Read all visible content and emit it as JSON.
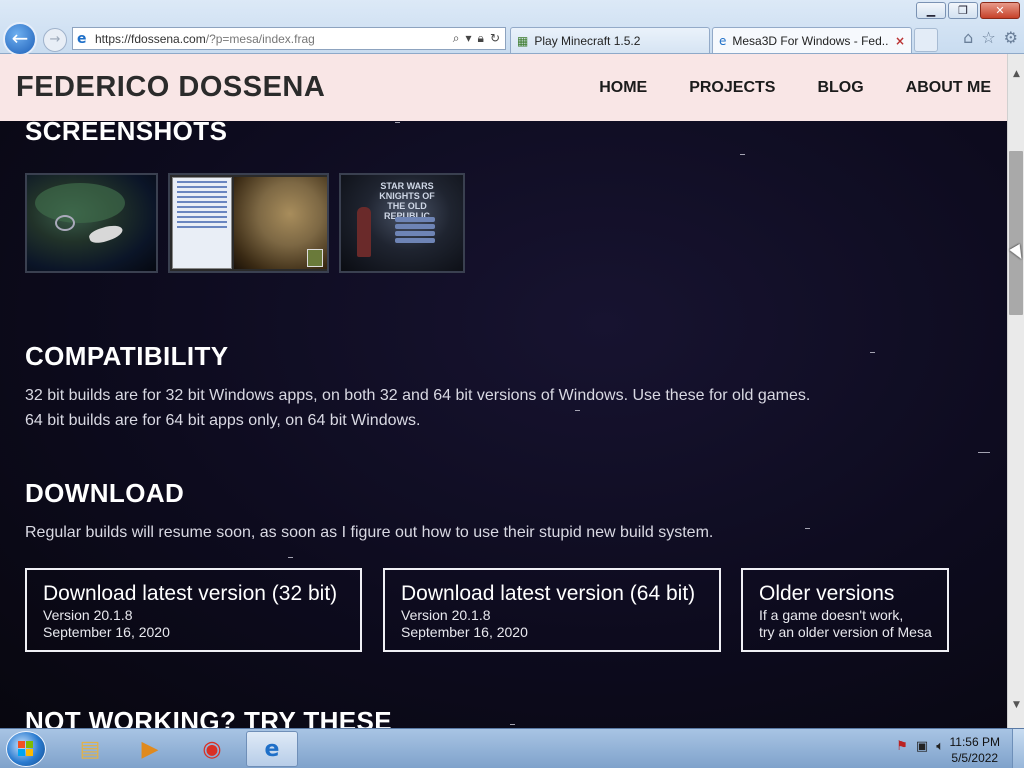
{
  "browser": {
    "address_url_main": "https://fdossena.com",
    "address_url_path": "/?p=mesa/index.frag",
    "tabs": [
      {
        "label": "Play Minecraft 1.5.2"
      },
      {
        "label": "Mesa3D For Windows - Fed..."
      }
    ],
    "window_buttons": {
      "minimize": "▁",
      "maximize": "❐",
      "close": "✕"
    }
  },
  "site": {
    "title": "FEDERICO DOSSENA",
    "nav": [
      "HOME",
      "PROJECTS",
      "BLOG",
      "ABOUT ME"
    ]
  },
  "sections": {
    "screenshots": {
      "heading": "SCREENSHOTS",
      "thumb3_caption": "STAR WARS KNIGHTS OF THE OLD REPUBLIC"
    },
    "compatibility": {
      "heading": "COMPATIBILITY",
      "line1": "32 bit builds are for 32 bit Windows apps, on both 32 and 64 bit versions of Windows. Use these for old games.",
      "line2": "64 bit builds are for 64 bit apps only, on 64 bit Windows."
    },
    "download": {
      "heading": "DOWNLOAD",
      "text": "Regular builds will resume soon, as soon as I figure out how to use their stupid new build system.",
      "buttons": [
        {
          "title": "Download latest version (32 bit)",
          "line1": "Version 20.1.8",
          "line2": "September 16, 2020"
        },
        {
          "title": "Download latest version (64 bit)",
          "line1": "Version 20.1.8",
          "line2": "September 16, 2020"
        },
        {
          "title": "Older versions",
          "line1": "If a game doesn't work,",
          "line2": "try an older version of Mesa"
        }
      ]
    },
    "not_working": {
      "heading": "NOT WORKING? TRY THESE"
    }
  },
  "taskbar": {
    "time": "11:56 PM",
    "date": "5/5/2022"
  },
  "colors": {
    "page_bg": "#0d0b1e",
    "header_bg": "#f9e6e6",
    "accent_ie": "#1e6fc8"
  }
}
